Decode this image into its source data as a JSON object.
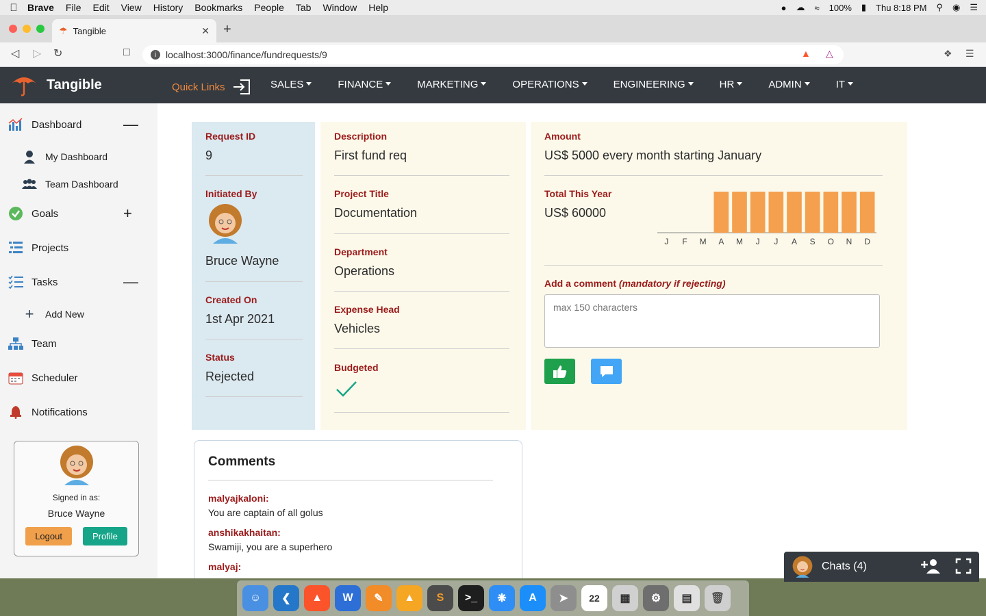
{
  "mac_menubar": {
    "app_name": "Brave",
    "items": [
      "File",
      "Edit",
      "View",
      "History",
      "Bookmarks",
      "People",
      "Tab",
      "Window",
      "Help"
    ],
    "battery": "100%",
    "clock": "Thu 8:18 PM"
  },
  "browser": {
    "tab_title": "Tangible",
    "url": "localhost:3000/finance/fundrequests/9"
  },
  "navbar": {
    "brand": "Tangible",
    "quick_links": "Quick Links",
    "items": [
      "SALES",
      "FINANCE",
      "MARKETING",
      "OPERATIONS",
      "ENGINEERING",
      "HR",
      "ADMIN",
      "IT"
    ]
  },
  "sidebar": {
    "dashboard": "Dashboard",
    "my_dashboard": "My Dashboard",
    "team_dashboard": "Team Dashboard",
    "goals": "Goals",
    "projects": "Projects",
    "tasks": "Tasks",
    "add_new": "Add New",
    "team": "Team",
    "scheduler": "Scheduler",
    "notifications": "Notifications",
    "signed_in_label": "Signed in as:",
    "user_name": "Bruce Wayne",
    "logout": "Logout",
    "profile": "Profile"
  },
  "request": {
    "request_id_label": "Request ID",
    "request_id": "9",
    "initiated_by_label": "Initiated By",
    "initiated_by": "Bruce Wayne",
    "created_on_label": "Created On",
    "created_on": "1st Apr 2021",
    "status_label": "Status",
    "status": "Rejected",
    "description_label": "Description",
    "description": "First fund req",
    "project_title_label": "Project Title",
    "project_title": "Documentation",
    "department_label": "Department",
    "department": "Operations",
    "expense_head_label": "Expense Head",
    "expense_head": "Vehicles",
    "budgeted_label": "Budgeted",
    "amount_label": "Amount",
    "amount": "US$ 5000 every month starting January",
    "total_label": "Total This Year",
    "total": "US$ 60000",
    "comment_label": "Add a comment",
    "comment_hint": "(mandatory if rejecting)",
    "comment_placeholder": "max 150 characters"
  },
  "chart_data": {
    "type": "bar",
    "categories": [
      "J",
      "F",
      "M",
      "A",
      "M",
      "J",
      "J",
      "A",
      "S",
      "O",
      "N",
      "D"
    ],
    "values": [
      0,
      0,
      0,
      5000,
      5000,
      5000,
      5000,
      5000,
      5000,
      5000,
      5000,
      5000
    ],
    "color": "#f5a04f",
    "ylim": [
      0,
      5000
    ]
  },
  "comments": {
    "title": "Comments",
    "items": [
      {
        "author": "malyajkaloni:",
        "text": "You are captain of all golus"
      },
      {
        "author": "anshikakhaitan:",
        "text": "Swamiji, you are a superhero"
      },
      {
        "author": "malyaj:",
        "text": ""
      }
    ]
  },
  "chat": {
    "label": "Chats (4)"
  },
  "colors": {
    "navbar_bg": "#343a40",
    "accent_orange": "#f0883e",
    "label_red": "#9b1b1b",
    "bar_orange": "#f5a04f",
    "like_green": "#1ea04c",
    "comment_blue": "#42a5f5"
  }
}
